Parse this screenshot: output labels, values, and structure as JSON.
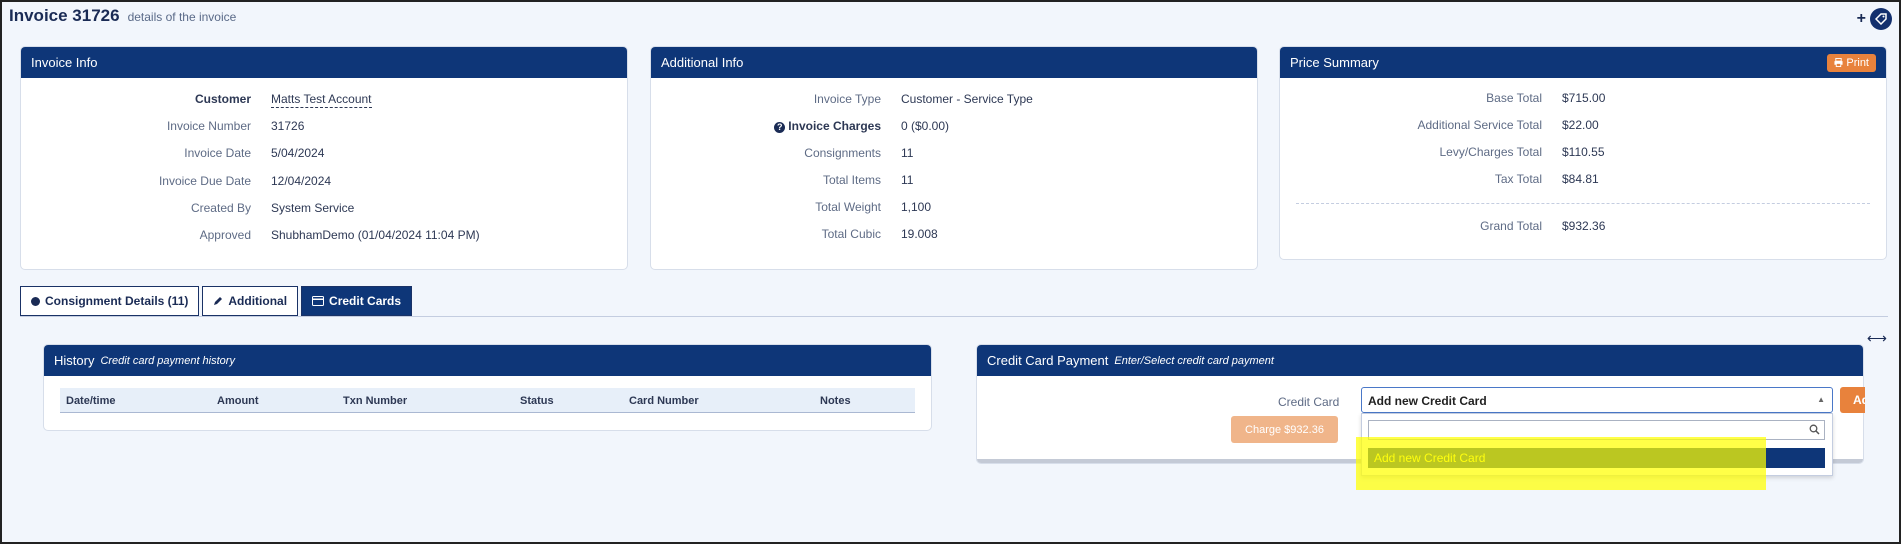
{
  "header": {
    "title": "Invoice 31726",
    "subtitle": "details of the invoice"
  },
  "icons": {
    "plus": "plus-icon",
    "tag": "tag-icon",
    "print": "printer-icon",
    "question": "question-icon",
    "search": "search-icon",
    "expand": "expand-arrows-icon",
    "pencil": "pencil-icon",
    "credit_card": "credit-card-icon",
    "circle": "circle-icon"
  },
  "invoice_info": {
    "title": "Invoice Info",
    "rows": [
      {
        "label": "Customer",
        "value": "Matts Test Account"
      },
      {
        "label": "Invoice Number",
        "value": "31726"
      },
      {
        "label": "Invoice Date",
        "value": "5/04/2024"
      },
      {
        "label": "Invoice Due Date",
        "value": "12/04/2024"
      },
      {
        "label": "Created By",
        "value": "System Service"
      },
      {
        "label": "Approved",
        "value": "ShubhamDemo (01/04/2024 11:04 PM)"
      }
    ]
  },
  "additional_info": {
    "title": "Additional Info",
    "rows": [
      {
        "label": "Invoice Type",
        "value": "Customer - Service Type"
      },
      {
        "label": "Invoice Charges",
        "value": "0 ($0.00)"
      },
      {
        "label": "Consignments",
        "value": "11"
      },
      {
        "label": "Total Items",
        "value": "11"
      },
      {
        "label": "Total Weight",
        "value": "1,100"
      },
      {
        "label": "Total Cubic",
        "value": "19.008"
      }
    ]
  },
  "price_summary": {
    "title": "Price Summary",
    "print_label": "Print",
    "rows": [
      {
        "label": "Base Total",
        "value": "$715.00"
      },
      {
        "label": "Additional Service Total",
        "value": "$22.00"
      },
      {
        "label": "Levy/Charges Total",
        "value": "$110.55"
      },
      {
        "label": "Tax Total",
        "value": "$84.81"
      }
    ],
    "grand_total": {
      "label": "Grand Total",
      "value": "$932.36"
    }
  },
  "tabs": [
    {
      "label": "Consignment Details (11)"
    },
    {
      "label": "Additional"
    },
    {
      "label": "Credit Cards"
    }
  ],
  "history": {
    "title": "History",
    "subtitle": "Credit card payment history",
    "columns": [
      "Date/time",
      "Amount",
      "Txn Number",
      "Status",
      "Card Number",
      "Notes"
    ]
  },
  "payment": {
    "title": "Credit Card Payment",
    "subtitle": "Enter/Select credit card payment",
    "field_label": "Credit Card",
    "selected": "Add new Credit Card",
    "add_button_label": "Ad",
    "charge_label": "Charge $932.36",
    "dropdown_option": "Add new Credit Card"
  },
  "colors": {
    "primary": "#0e3678",
    "accent": "#e8823c",
    "highlight": "#ffff00"
  }
}
